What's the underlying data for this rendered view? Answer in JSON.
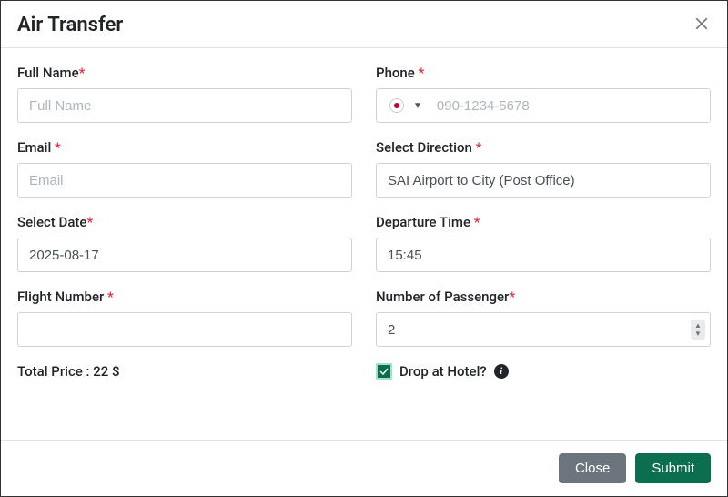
{
  "modal": {
    "title": "Air Transfer",
    "close_button": "Close",
    "submit_button": "Submit"
  },
  "form": {
    "full_name": {
      "label": "Full Name",
      "placeholder": "Full Name",
      "value": ""
    },
    "phone": {
      "label": "Phone",
      "placeholder": "090-1234-5678",
      "value": "",
      "country": "jp"
    },
    "email": {
      "label": "Email",
      "placeholder": "Email",
      "value": ""
    },
    "direction": {
      "label": "Select Direction",
      "value": "SAI Airport to City (Post Office)"
    },
    "date": {
      "label": "Select Date",
      "value": "2025-08-17"
    },
    "departure": {
      "label": "Departure Time",
      "value": "15:45"
    },
    "flight_number": {
      "label": "Flight Number",
      "value": ""
    },
    "passengers": {
      "label": "Number of Passenger",
      "value": "2"
    },
    "drop_hotel": {
      "label": "Drop at Hotel?",
      "checked": true
    }
  },
  "total": {
    "label": "Total Price :",
    "value": "22 $"
  }
}
